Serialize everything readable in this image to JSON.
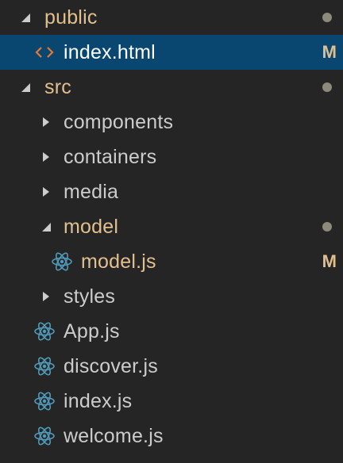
{
  "explorer": {
    "items": [
      {
        "label": "public",
        "type": "folder",
        "expanded": true,
        "modified": true,
        "icon": "folder-expanded-icon"
      },
      {
        "label": "index.html",
        "type": "file",
        "icon": "html-code-icon",
        "selected": true,
        "status": "M"
      },
      {
        "label": "src",
        "type": "folder",
        "expanded": true,
        "modified": true,
        "icon": "folder-expanded-icon"
      },
      {
        "label": "components",
        "type": "folder",
        "expanded": false,
        "icon": "folder-collapsed-icon"
      },
      {
        "label": "containers",
        "type": "folder",
        "expanded": false,
        "icon": "folder-collapsed-icon"
      },
      {
        "label": "media",
        "type": "folder",
        "expanded": false,
        "icon": "folder-collapsed-icon"
      },
      {
        "label": "model",
        "type": "folder",
        "expanded": true,
        "modified": true,
        "icon": "folder-expanded-icon"
      },
      {
        "label": "model.js",
        "type": "file",
        "icon": "react-icon",
        "status": "M"
      },
      {
        "label": "styles",
        "type": "folder",
        "expanded": false,
        "icon": "folder-collapsed-icon"
      },
      {
        "label": "App.js",
        "type": "file",
        "icon": "react-icon"
      },
      {
        "label": "discover.js",
        "type": "file",
        "icon": "react-icon"
      },
      {
        "label": "index.js",
        "type": "file",
        "icon": "react-icon"
      },
      {
        "label": "welcome.js",
        "type": "file",
        "icon": "react-icon"
      }
    ]
  },
  "colors": {
    "background": "#252526",
    "selected_background": "#094771",
    "text": "#cccccc",
    "modified_text": "#e2c08d",
    "react_icon": "#519aba",
    "html_icon": "#e37933",
    "modified_dot": "#8b8b7a"
  }
}
